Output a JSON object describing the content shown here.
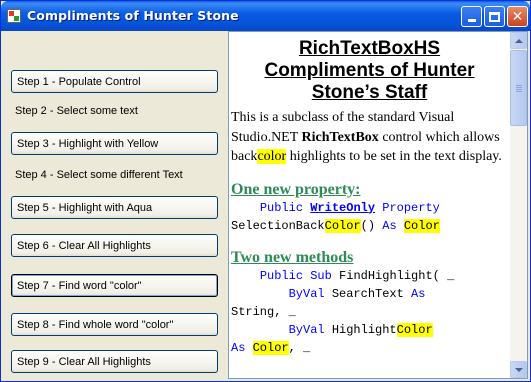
{
  "window": {
    "title": "Compliments of Hunter Stone"
  },
  "steps": {
    "step1": "Step 1 - Populate Control",
    "step2": "Step 2 - Select some text",
    "step3": "Step 3 - Highlight with Yellow",
    "step4": "Step 4 - Select some different Text",
    "step5": "Step 5 - Highlight with Aqua",
    "step6": "Step 6 - Clear All Highlights",
    "step7": "Step 7 - Find word \"color\"",
    "step8": "Step 8 - Find  whole word \"color\"",
    "step9": "Step 9 - Clear All Highlights"
  },
  "rtb": {
    "heading_line1": "RichTextBoxHS",
    "heading_line2": "Compliments of Hunter",
    "heading_line3": "Stone’s Staff",
    "para_part1": "This is a subclass of the standard Visual Studio.NET ",
    "para_bold": "RichTextBox",
    "para_part2": " control which allows back",
    "para_hl": "color",
    "para_part3": " highlights to be set in the text display.",
    "section1": "One new property:",
    "code1_indent": "    ",
    "code1_public": "Public",
    "code1_writeonly": "WriteOnly",
    "code1_property": "Property",
    "code2_name": "SelectionBack",
    "code2_color": "Color",
    "code2_parens": "() ",
    "code2_as": "As",
    "code2_type": "Color",
    "section2": "Two new methods",
    "m1_indent": "    ",
    "m1_public": "Public",
    "m1_sub": "Sub",
    "m1_name": " FindHighlight( _",
    "m2_indent": "        ",
    "m2_byval": "ByVal",
    "m2_param": " SearchText ",
    "m2_as": "As",
    "m3_type": "String, _",
    "m4_indent": "        ",
    "m4_byval": "ByVal",
    "m4_param_a": " Highlight",
    "m4_param_hl": "Color",
    "m5_as": "As",
    "m5_type": "Color",
    "m5_rest": ", _"
  },
  "colors": {
    "highlight": "#ffff00",
    "keyword": "#0000ff",
    "section_heading": "#2e8b57"
  },
  "icons": {
    "app": "app-icon",
    "minimize": "minimize-icon",
    "maximize": "maximize-icon",
    "close": "close-icon",
    "scroll_up": "scroll-up-icon",
    "scroll_down": "scroll-down-icon"
  }
}
